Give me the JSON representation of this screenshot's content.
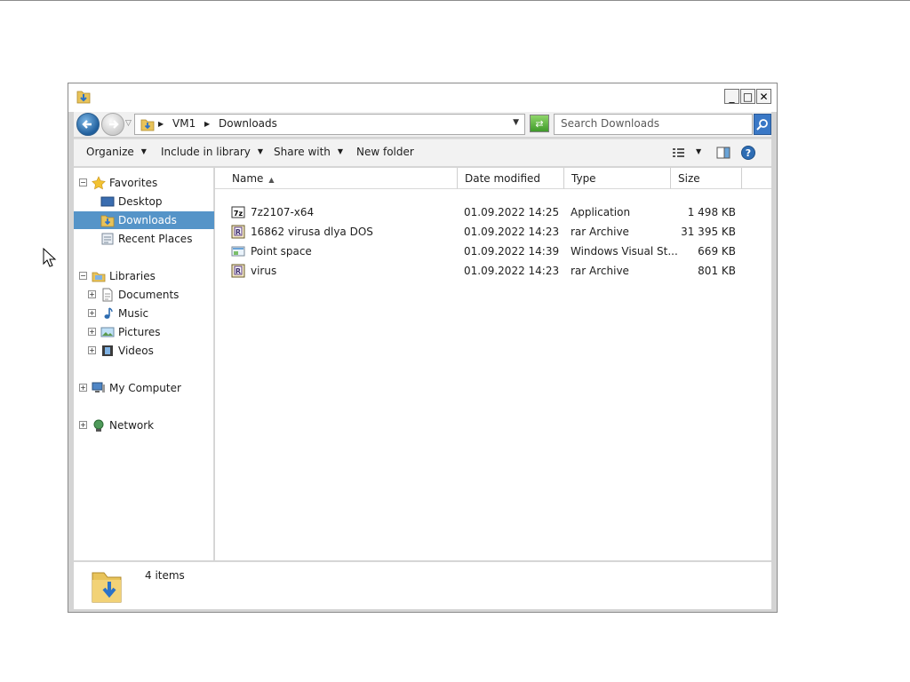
{
  "window": {
    "min_glyph": "_",
    "max_glyph": "□",
    "close_glyph": "✕"
  },
  "address": {
    "crumbs": [
      "VM1",
      "Downloads"
    ],
    "search_placeholder": "Search Downloads"
  },
  "toolbar": {
    "organize": "Organize",
    "include_in_library": "Include in library",
    "share_with": "Share with",
    "new_folder": "New folder"
  },
  "nav": {
    "favorites": {
      "label": "Favorites",
      "items": [
        {
          "label": "Desktop",
          "icon": "desktop-icon"
        },
        {
          "label": "Downloads",
          "icon": "downloads-folder-icon",
          "selected": true
        },
        {
          "label": "Recent Places",
          "icon": "recent-places-icon"
        }
      ]
    },
    "libraries": {
      "label": "Libraries",
      "items": [
        {
          "label": "Documents",
          "icon": "documents-icon"
        },
        {
          "label": "Music",
          "icon": "music-icon"
        },
        {
          "label": "Pictures",
          "icon": "pictures-icon"
        },
        {
          "label": "Videos",
          "icon": "videos-icon"
        }
      ]
    },
    "computer": {
      "label": "My Computer"
    },
    "network": {
      "label": "Network"
    }
  },
  "columns": [
    "Name",
    "Date modified",
    "Type",
    "Size"
  ],
  "files": [
    {
      "name": "7z2107-x64",
      "date": "01.09.2022 14:25",
      "type": "Application",
      "size": "1 498 KB",
      "icon": "7zip-app-icon"
    },
    {
      "name": "16862 virusa dlya DOS",
      "date": "01.09.2022 14:23",
      "type": "rar Archive",
      "size": "31 395 KB",
      "icon": "rar-archive-icon"
    },
    {
      "name": "Point space",
      "date": "01.09.2022 14:39",
      "type": "Windows Visual St...",
      "size": "669 KB",
      "icon": "visual-style-icon"
    },
    {
      "name": "virus",
      "date": "01.09.2022 14:23",
      "type": "rar Archive",
      "size": "801 KB",
      "icon": "rar-archive-icon"
    }
  ],
  "status": {
    "item_count": "4 items"
  }
}
